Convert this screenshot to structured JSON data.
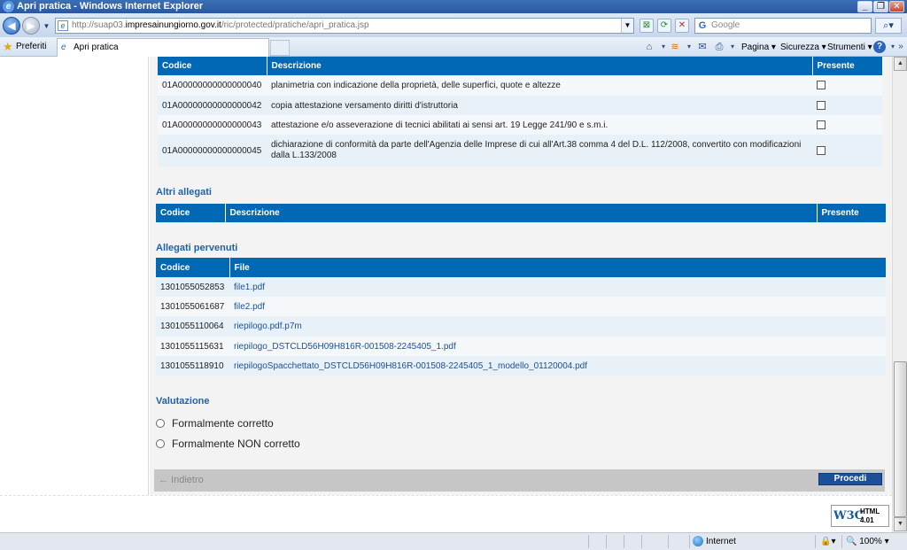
{
  "window": {
    "title": "Apri pratica - Windows Internet Explorer"
  },
  "address": {
    "url_prefix": "http://suap03.",
    "url_host": "impresainungiorno.gov.it",
    "url_path": "/ric/protected/pratiche/apri_pratica.jsp",
    "search_placeholder": "Google"
  },
  "tabbar": {
    "favorites_label": "Preferiti",
    "tab_label": "Apri pratica",
    "menu_pagina": "Pagina",
    "menu_sicurezza": "Sicurezza",
    "menu_strumenti": "Strumenti"
  },
  "allegati_richiesti": {
    "headers": {
      "codice": "Codice",
      "descrizione": "Descrizione",
      "presente": "Presente"
    },
    "rows": [
      {
        "codice": "01A00000000000000040",
        "descrizione": "planimetria con indicazione della proprietà, delle superfici, quote e altezze"
      },
      {
        "codice": "01A00000000000000042",
        "descrizione": "copia attestazione versamento diritti d'istruttoria"
      },
      {
        "codice": "01A00000000000000043",
        "descrizione": "attestazione e/o asseverazione di tecnici abilitati ai sensi art. 19 Legge 241/90 e s.m.i."
      },
      {
        "codice": "01A00000000000000045",
        "descrizione_line1": "dichiarazione di conformità da parte dell'Agenzia delle Imprese di cui all'Art.38 comma 4 del D.L. 112/2008, convertito con modificazioni",
        "descrizione_line2": "dalla L.133/2008"
      }
    ]
  },
  "altri_allegati": {
    "title": "Altri allegati",
    "headers": {
      "codice": "Codice",
      "descrizione": "Descrizione",
      "presente": "Presente"
    }
  },
  "allegati_pervenuti": {
    "title": "Allegati pervenuti",
    "headers": {
      "codice": "Codice",
      "file": "File"
    },
    "rows": [
      {
        "codice": "1301055052853",
        "file": "file1.pdf"
      },
      {
        "codice": "1301055061687",
        "file": "file2.pdf"
      },
      {
        "codice": "1301055110064",
        "file": "riepilogo.pdf.p7m"
      },
      {
        "codice": "1301055115631",
        "file": "riepilogo_DSTCLD56H09H816R-001508-2245405_1.pdf"
      },
      {
        "codice": "1301055118910",
        "file": "riepilogoSpacchettato_DSTCLD56H09H816R-001508-2245405_1_modello_01120004.pdf"
      }
    ]
  },
  "valutazione": {
    "title": "Valutazione",
    "option1": "Formalmente corretto",
    "option2": "Formalmente NON corretto"
  },
  "actions": {
    "back": "← Indietro",
    "proceed": "Procedi"
  },
  "badge": {
    "w3c": "W3C",
    "html": "HTML",
    "version": "4.01"
  },
  "statusbar": {
    "zone": "Internet",
    "zoom": "100%"
  }
}
